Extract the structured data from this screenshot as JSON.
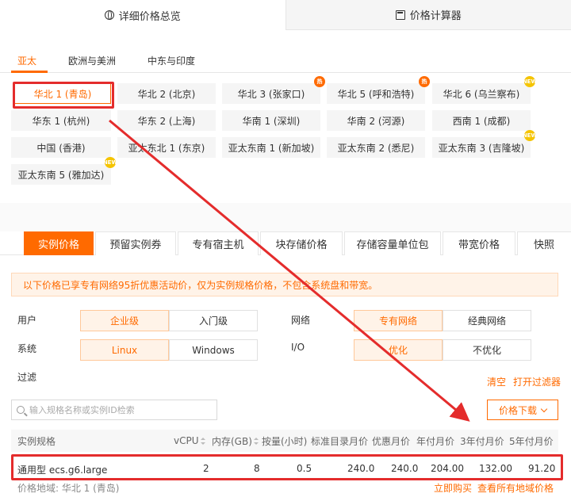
{
  "top_tabs": [
    {
      "label": "详细价格总览",
      "icon": "globe-icon"
    },
    {
      "label": "价格计算器",
      "icon": "calculator-icon"
    }
  ],
  "region_tabs": [
    "亚太",
    "欧洲与美洲",
    "中东与印度"
  ],
  "regions": [
    {
      "label": "华北 1 (青岛)"
    },
    {
      "label": "华北 2 (北京)"
    },
    {
      "label": "华北 3 (张家口)",
      "badge": "hot"
    },
    {
      "label": "华北 5 (呼和浩特)",
      "badge": "hot"
    },
    {
      "label": "华北 6 (乌兰察布)",
      "badge": "new"
    },
    {
      "label": "华东 1 (杭州)"
    },
    {
      "label": "华东 2 (上海)"
    },
    {
      "label": "华南 1 (深圳)"
    },
    {
      "label": "华南 2 (河源)"
    },
    {
      "label": "西南 1 (成都)"
    },
    {
      "label": "中国 (香港)"
    },
    {
      "label": "亚太东北 1 (东京)"
    },
    {
      "label": "亚太东南 1 (新加坡)"
    },
    {
      "label": "亚太东南 2 (悉尼)"
    },
    {
      "label": "亚太东南 3 (吉隆坡)",
      "badge": "new"
    },
    {
      "label": "亚太东南 5 (雅加达)",
      "badge": "new"
    }
  ],
  "price_tabs": [
    "实例价格",
    "预留实例券",
    "专有宿主机",
    "块存储价格",
    "存储容量单位包",
    "带宽价格",
    "快照"
  ],
  "notice": "以下价格已享专有网络95折优惠活动价，仅为实例规格价格，不包含系统盘和带宽。",
  "filters": {
    "user_label": "用户",
    "user_options": [
      "企业级",
      "入门级"
    ],
    "system_label": "系统",
    "system_options": [
      "Linux",
      "Windows"
    ],
    "network_label": "网络",
    "network_options": [
      "专有网络",
      "经典网络"
    ],
    "io_label": "I/O",
    "io_options": [
      "优化",
      "不优化"
    ],
    "filter_label": "过滤",
    "clear": "清空",
    "open_filter": "打开过滤器"
  },
  "search": {
    "placeholder": "输入规格名称或实例ID检索"
  },
  "download_label": "价格下载",
  "table": {
    "headers": [
      "实例规格",
      "vCPU",
      "内存(GB)",
      "按量(小时)",
      "标准目录月价",
      "优惠月价",
      "年付月价",
      "3年付月价",
      "5年付月价"
    ],
    "row": [
      "通用型 ecs.g6.large",
      "2",
      "8",
      "0.5",
      "240.0",
      "240.0",
      "204.00",
      "132.00",
      "91.20"
    ]
  },
  "footer": {
    "price_region_label": "价格地域: 华北 1 (青岛)",
    "buy_now": "立即购买",
    "view_all_regions": "查看所有地域价格"
  }
}
